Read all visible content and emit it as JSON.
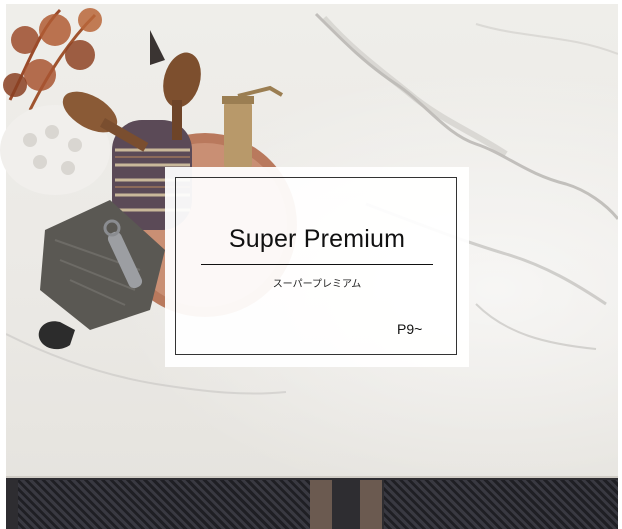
{
  "banner": {
    "title": "Super Premium",
    "subtitle": "スーパープレミアム",
    "page_ref": "P9~"
  },
  "colors": {
    "marble": "#eceae6",
    "card_bg": "#ffffff",
    "text": "#111111",
    "base": "#2e2d31"
  }
}
